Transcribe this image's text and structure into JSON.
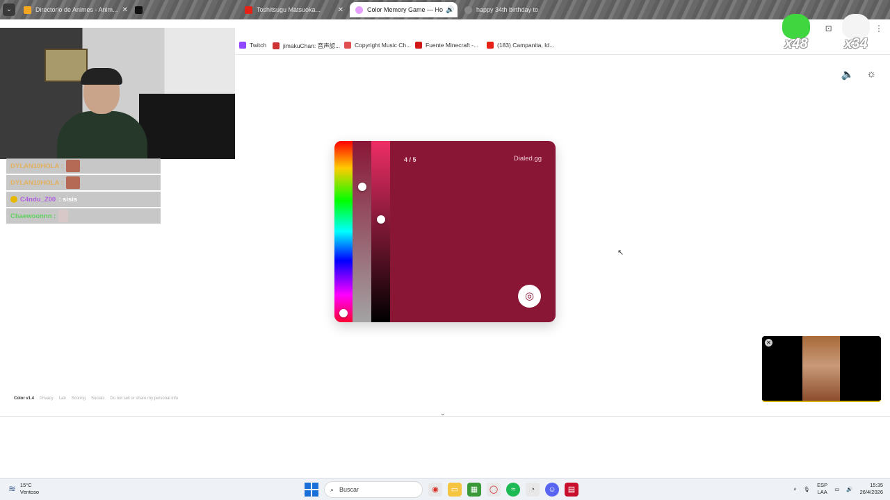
{
  "browser": {
    "tabs": [
      {
        "title": "Directorio de Animes - Anim...",
        "favicon_color": "#f5a623",
        "active": false
      },
      {
        "title": "",
        "favicon_color": "#111111",
        "active": false
      },
      {
        "title": "Toshitsugu Matsuoka...",
        "favicon_color": "#e62117",
        "active": false
      },
      {
        "title": "Color Memory Game — Ho",
        "favicon_color": "#e8a0ff",
        "active": true
      },
      {
        "title": "happy 34th birthday to",
        "favicon_color": "#888888",
        "active": false
      }
    ],
    "bookmarks": [
      {
        "label": "Twitch",
        "color": "#9146ff"
      },
      {
        "label": "jimakuChan: 音声認...",
        "color": "#cc3333"
      },
      {
        "label": "Copyright Music Ch...",
        "color": "#e05050"
      },
      {
        "label": "Fuente Minecraft -...",
        "color": "#d01818"
      },
      {
        "label": "(183) Campanita, Id...",
        "color": "#e62117"
      }
    ]
  },
  "stream": {
    "chat": [
      {
        "user": "DYLAN10HOLA :",
        "user_color": "#e0b060",
        "message": ""
      },
      {
        "user": "DYLAN10HOLA :",
        "user_color": "#e0b060",
        "message": ""
      },
      {
        "user": "C4ndu_Z00",
        "user_color": "#b060e0",
        "message": ": sisis"
      },
      {
        "user": "Chaewoonnn :",
        "user_color": "#60d060",
        "message": ""
      }
    ],
    "counters": [
      {
        "value": "x48",
        "color": "#3fd63f"
      },
      {
        "value": "x34",
        "color": "#f4f4f4"
      }
    ]
  },
  "game": {
    "round": "4 / 5",
    "brand": "Dialed.gg",
    "target_color": "#8a1636",
    "sliders": {
      "hue_fraction": 0.97,
      "saturation_fraction": 0.24,
      "brightness_fraction": 0.43
    }
  },
  "footer": {
    "version": "Color v1.4",
    "links": [
      "Privacy",
      "Lab",
      "Scoring",
      "Socials",
      "Do not sell or share my personal info"
    ]
  },
  "taskbar": {
    "temperature": "15°C",
    "weather": "Ventoso",
    "search_placeholder": "Buscar",
    "lang_top": "ESP",
    "lang_bottom": "LAA",
    "time": "15:35",
    "date": "26/4/2026"
  }
}
